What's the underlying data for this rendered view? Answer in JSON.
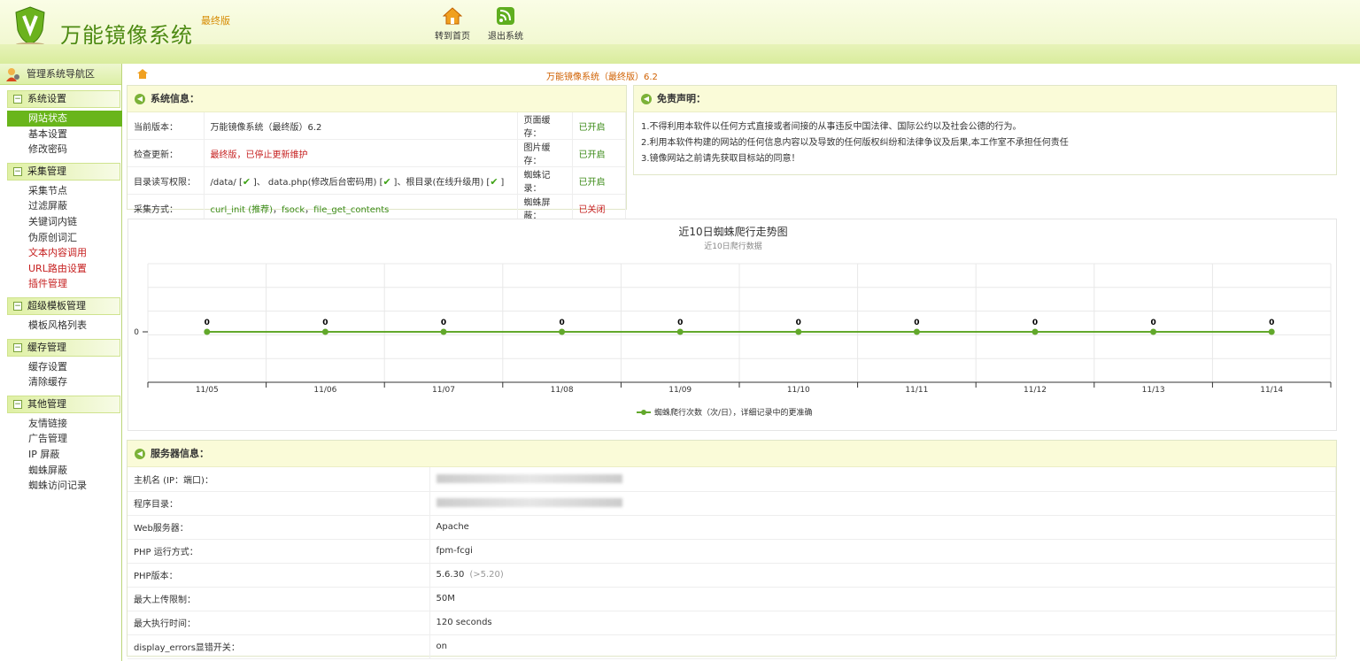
{
  "header": {
    "title": "万能镜像系统",
    "edition": "最终版",
    "nav": [
      {
        "label": "转到首页",
        "icon": "home-icon"
      },
      {
        "label": "退出系统",
        "icon": "rss-icon"
      }
    ]
  },
  "sidebar": {
    "title": "管理系统导航区",
    "groups": [
      {
        "label": "系统设置",
        "items": [
          {
            "label": "网站状态",
            "active": true
          },
          {
            "label": "基本设置"
          },
          {
            "label": "修改密码"
          }
        ]
      },
      {
        "label": "采集管理",
        "items": [
          {
            "label": "采集节点"
          },
          {
            "label": "过滤屏蔽"
          },
          {
            "label": "关键词内链"
          },
          {
            "label": "伪原创词汇"
          },
          {
            "label": "文本内容调用",
            "red": true
          },
          {
            "label": "URL路由设置",
            "red": true
          },
          {
            "label": "插件管理",
            "red": true
          }
        ]
      },
      {
        "label": "超级模板管理",
        "items": [
          {
            "label": "模板风格列表"
          }
        ]
      },
      {
        "label": "缓存管理",
        "items": [
          {
            "label": "缓存设置"
          },
          {
            "label": "清除缓存"
          }
        ]
      },
      {
        "label": "其他管理",
        "items": [
          {
            "label": "友情链接"
          },
          {
            "label": "广告管理"
          },
          {
            "label": "IP 屏蔽"
          },
          {
            "label": "蜘蛛屏蔽"
          },
          {
            "label": "蜘蛛访问记录"
          }
        ]
      }
    ]
  },
  "breadcrumb": "万能镜像系统（最终版）6.2",
  "sysinfo": {
    "title": "系统信息：",
    "version_label": "当前版本：",
    "version": "万能镜像系统（最终版）6.2",
    "update_label": "检查更新：",
    "update": "最终版，已停止更新维护",
    "perm_label": "目录读写权限：",
    "perm_a": "/data/ [",
    "perm_b": "]、 data.php(修改后台密码用) [",
    "perm_c": "]、根目录(在线升级用) [",
    "perm_d": "]",
    "method_label": "采集方式：",
    "method_a": "curl_init (推荐)",
    "method_b": "fsock",
    "method_c": "file_get_contents",
    "sep": "，",
    "right": [
      {
        "label": "页面缓存：",
        "value": "已开启",
        "on": true
      },
      {
        "label": "图片缓存：",
        "value": "已开启",
        "on": true
      },
      {
        "label": "蜘蛛记录：",
        "value": "已开启",
        "on": true
      },
      {
        "label": "蜘蛛屏蔽：",
        "value": "已关闭",
        "on": false
      }
    ]
  },
  "disclaimer": {
    "title": "免责声明：",
    "lines": [
      "1.不得利用本软件以任何方式直接或者间接的从事违反中国法律、国际公约以及社会公德的行为。",
      "2.利用本软件构建的网站的任何信息内容以及导致的任何版权纠纷和法律争议及后果,本工作室不承担任何责任",
      "3.镜像网站之前请先获取目标站的同意！"
    ]
  },
  "chart_data": {
    "type": "line",
    "title": "近10日蜘蛛爬行走势图",
    "subtitle": "近10日爬行数据",
    "categories": [
      "11/05",
      "11/06",
      "11/07",
      "11/08",
      "11/09",
      "11/10",
      "11/11",
      "11/12",
      "11/13",
      "11/14"
    ],
    "series": [
      {
        "name": "蜘蛛爬行次数（次/日），详细记录中的更准确",
        "values": [
          0,
          0,
          0,
          0,
          0,
          0,
          0,
          0,
          0,
          0
        ]
      }
    ],
    "yticks": [
      "0"
    ],
    "color": "#62a82b"
  },
  "server": {
    "title": "服务器信息：",
    "rows": [
      {
        "label": "主机名 (IP：端口)：",
        "value": ""
      },
      {
        "label": "程序目录：",
        "value": ""
      },
      {
        "label": "Web服务器：",
        "value": "Apache"
      },
      {
        "label": "PHP 运行方式：",
        "value": "fpm-fcgi"
      },
      {
        "label": "PHP版本：",
        "value": "5.6.30",
        "note": "(>5.20)"
      },
      {
        "label": "最大上传限制：",
        "value": "50M"
      },
      {
        "label": "最大执行时间：",
        "value": "120 seconds"
      },
      {
        "label": "display_errors显错开关：",
        "value": "on"
      }
    ]
  }
}
